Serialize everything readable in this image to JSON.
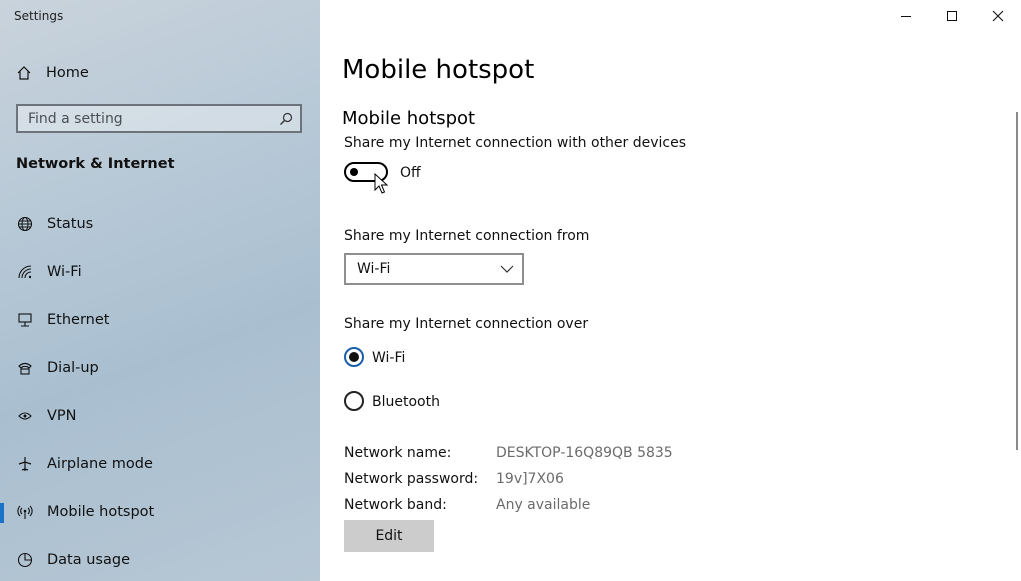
{
  "window": {
    "title": "Settings",
    "controls": [
      "minimize",
      "maximize",
      "close"
    ]
  },
  "sidebar": {
    "home_label": "Home",
    "search": {
      "placeholder": "Find a setting",
      "value": ""
    },
    "section_title": "Network & Internet",
    "items": [
      {
        "label": "Status",
        "icon": "globe-icon",
        "active": false
      },
      {
        "label": "Wi-Fi",
        "icon": "wifi-icon",
        "active": false
      },
      {
        "label": "Ethernet",
        "icon": "ethernet-icon",
        "active": false
      },
      {
        "label": "Dial-up",
        "icon": "dialup-icon",
        "active": false
      },
      {
        "label": "VPN",
        "icon": "vpn-icon",
        "active": false
      },
      {
        "label": "Airplane mode",
        "icon": "airplane-icon",
        "active": false
      },
      {
        "label": "Mobile hotspot",
        "icon": "hotspot-icon",
        "active": true
      },
      {
        "label": "Data usage",
        "icon": "data-usage-icon",
        "active": false
      }
    ],
    "accent": "#1a73c9"
  },
  "main": {
    "page_title": "Mobile hotspot",
    "hotspot": {
      "group_title": "Mobile hotspot",
      "share_label": "Share my Internet connection with other devices",
      "toggle_state": "Off"
    },
    "share_from": {
      "label": "Share my Internet connection from",
      "selected": "Wi-Fi"
    },
    "share_over": {
      "label": "Share my Internet connection over",
      "options": [
        {
          "label": "Wi-Fi",
          "checked": true
        },
        {
          "label": "Bluetooth",
          "checked": false
        }
      ]
    },
    "network": {
      "name_label": "Network name:",
      "name_value": "DESKTOP-16Q89QB 5835",
      "password_label": "Network password:",
      "password_value": "19v]7X06",
      "band_label": "Network band:",
      "band_value": "Any available"
    },
    "edit_label": "Edit"
  }
}
